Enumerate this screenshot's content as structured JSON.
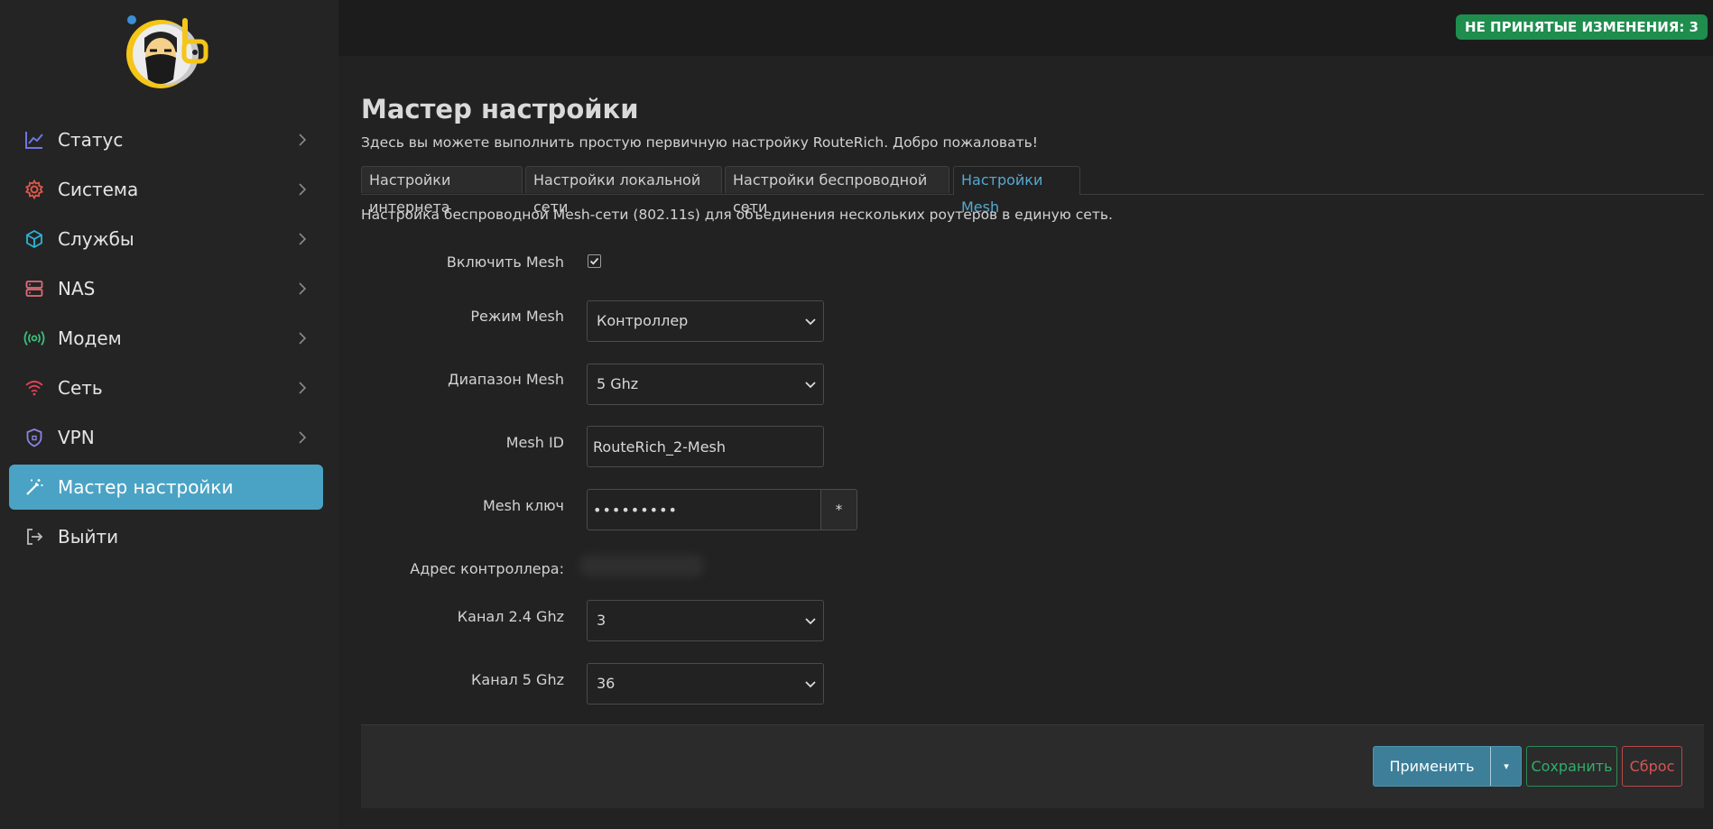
{
  "sidebar": {
    "items": [
      {
        "label": "Статус",
        "icon": "chart-line-icon",
        "color": "#6c78e0"
      },
      {
        "label": "Система",
        "icon": "gear-icon",
        "color": "#e0584c"
      },
      {
        "label": "Службы",
        "icon": "cube-icon",
        "color": "#2bb4d8"
      },
      {
        "label": "NAS",
        "icon": "server-icon",
        "color": "#e06c78"
      },
      {
        "label": "Модем",
        "icon": "broadcast-icon",
        "color": "#39c07a"
      },
      {
        "label": "Сеть",
        "icon": "wifi-icon",
        "color": "#e0425a"
      },
      {
        "label": "VPN",
        "icon": "shield-icon",
        "color": "#8a84e0"
      },
      {
        "label": "Мастер настройки",
        "icon": "magic-wand-icon",
        "color": "#ffffff",
        "active": true
      },
      {
        "label": "Выйти",
        "icon": "logout-icon",
        "color": "#bcbcbc"
      }
    ]
  },
  "header": {
    "badge": "НЕ ПРИНЯТЫЕ ИЗМЕНЕНИЯ: 3"
  },
  "main": {
    "title": "Мастер настройки",
    "description": "Здесь вы можете выполнить простую первичную настройку RouteRich. Добро пожаловать!",
    "tabs": [
      {
        "label": "Настройки интернета"
      },
      {
        "label": "Настройки локальной сети"
      },
      {
        "label": "Настройки беспроводной сети"
      },
      {
        "label": "Настройки Mesh",
        "active": true
      }
    ],
    "section_description": "Настройка беспроводной Mesh-сети (802.11s) для объединения нескольких роутеров в единую сеть.",
    "form": {
      "enable_mesh_label": "Включить Mesh",
      "enable_mesh_checked": true,
      "mode_label": "Режим Mesh",
      "mode_value": "Контроллер",
      "band_label": "Диапазон Mesh",
      "band_value": "5 Ghz",
      "mesh_id_label": "Mesh ID",
      "mesh_id_value": "RouteRich_2-Mesh",
      "mesh_key_label": "Mesh ключ",
      "mesh_key_value": "•••••••••",
      "mesh_key_reveal": "*",
      "controller_address_label": "Адрес контроллера:",
      "channel_24_label": "Канал 2.4 Ghz",
      "channel_24_value": "3",
      "channel_5_label": "Канал 5 Ghz",
      "channel_5_value": "36"
    },
    "actions": {
      "apply": "Применить",
      "apply_caret": "▾",
      "save": "Сохранить",
      "reset": "Сброс"
    }
  },
  "colors": {
    "accent": "#4aa3c5",
    "badge": "#1f8d4e",
    "save": "#2fae6a",
    "reset": "#d85555"
  }
}
